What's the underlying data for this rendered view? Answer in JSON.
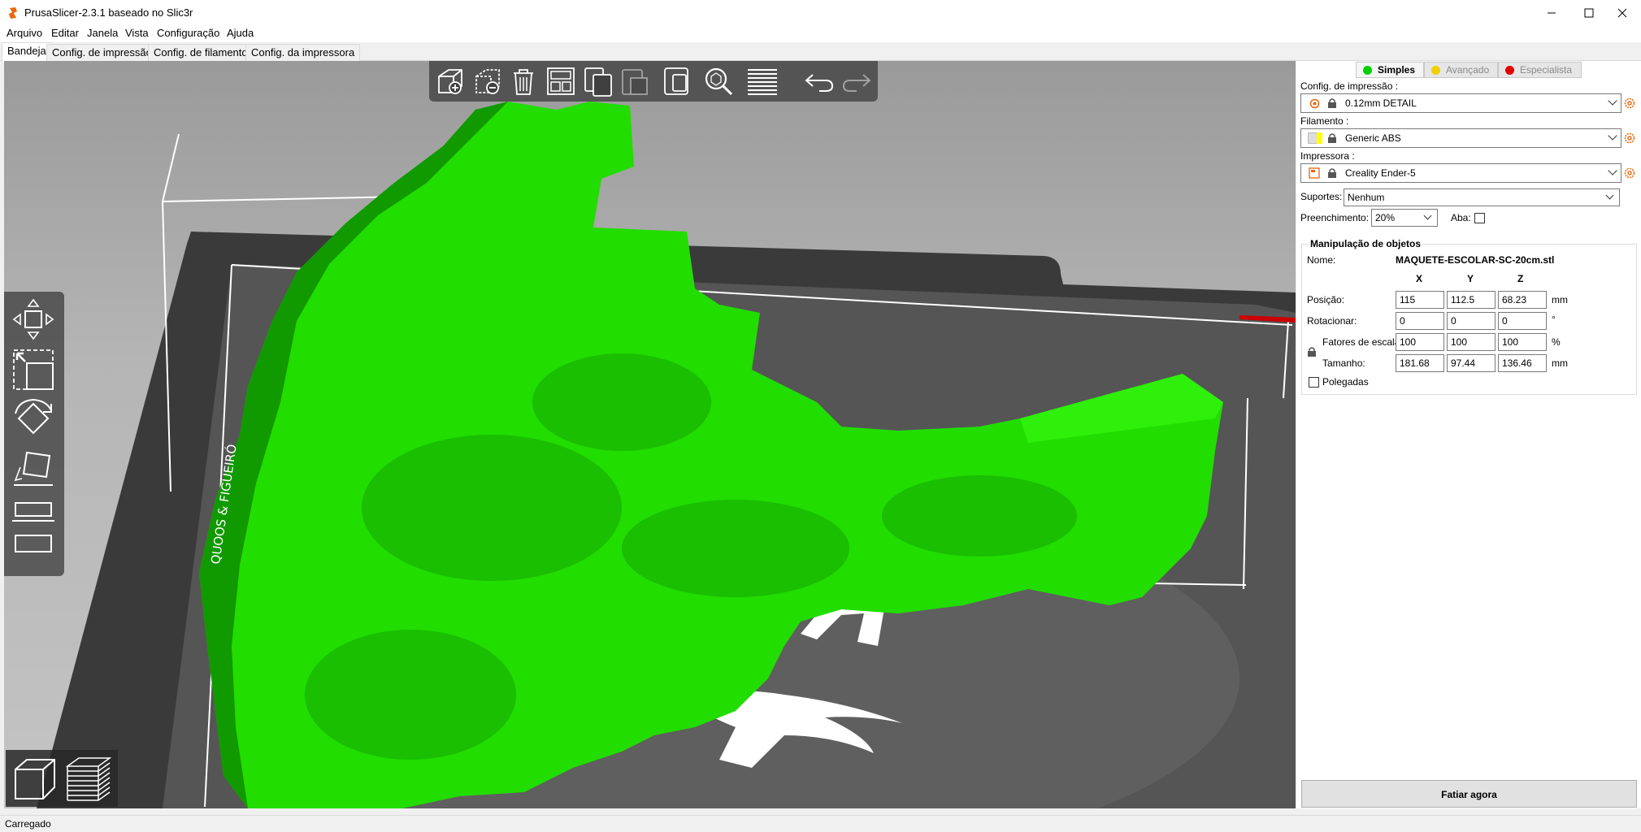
{
  "window": {
    "title": "PrusaSlicer-2.3.1 baseado no Slic3r"
  },
  "menu": [
    "Arquivo",
    "Editar",
    "Janela",
    "Vista",
    "Configuração",
    "Ajuda"
  ],
  "tabs": [
    "Bandeja",
    "Config. de impressão",
    "Config. de filamento",
    "Config. da impressora"
  ],
  "viewport": {
    "bed_label": "QUOOS & FIGUEIRÓ",
    "model_color": "#22dd00",
    "toolbar_icons": [
      "add-icon",
      "delete-icon",
      "delete-all-icon",
      "arrange-icon",
      "copy-icon",
      "paste-icon",
      "instances-icon",
      "search-icon",
      "layers-editing-icon",
      "undo-icon",
      "redo-icon"
    ],
    "left_tool_icons": [
      "move-icon",
      "scale-icon",
      "rotate-icon",
      "place-on-face-icon",
      "cut-icon",
      "support-paint-icon"
    ]
  },
  "sidebar": {
    "modes": [
      {
        "label": "Simples",
        "color": "#00d000"
      },
      {
        "label": "Avançado",
        "color": "#f0d000"
      },
      {
        "label": "Especialista",
        "color": "#e00000"
      }
    ],
    "print_label": "Config. de impressão :",
    "print_value": "0.12mm DETAIL",
    "filament_label": "Filamento :",
    "filament_value": "Generic ABS",
    "filament_color": "#ffff00",
    "printer_label": "Impressora :",
    "printer_value": "Creality Ender-5",
    "supports_label": "Suportes:",
    "supports_value": "Nenhum",
    "infill_label": "Preenchimento:",
    "infill_value": "20%",
    "brim_label": "Aba:",
    "object": {
      "group_title": "Manipulação de objetos",
      "name_label": "Nome:",
      "name_value": "MAQUETE-ESCOLAR-SC-20cm.stl",
      "axes": [
        "X",
        "Y",
        "Z"
      ],
      "position_label": "Posição:",
      "position": [
        "115",
        "112.5",
        "68.23"
      ],
      "position_unit": "mm",
      "rotation_label": "Rotacionar:",
      "rotation": [
        "0",
        "0",
        "0"
      ],
      "rotation_unit": "°",
      "scale_label": "Fatores de escala:",
      "scale": [
        "100",
        "100",
        "100"
      ],
      "scale_unit": "%",
      "size_label": "Tamanho:",
      "size": [
        "181.68",
        "97.44",
        "136.46"
      ],
      "size_unit": "mm",
      "inches_label": "Polegadas"
    },
    "slice_button": "Fatiar agora"
  },
  "status": "Carregado"
}
